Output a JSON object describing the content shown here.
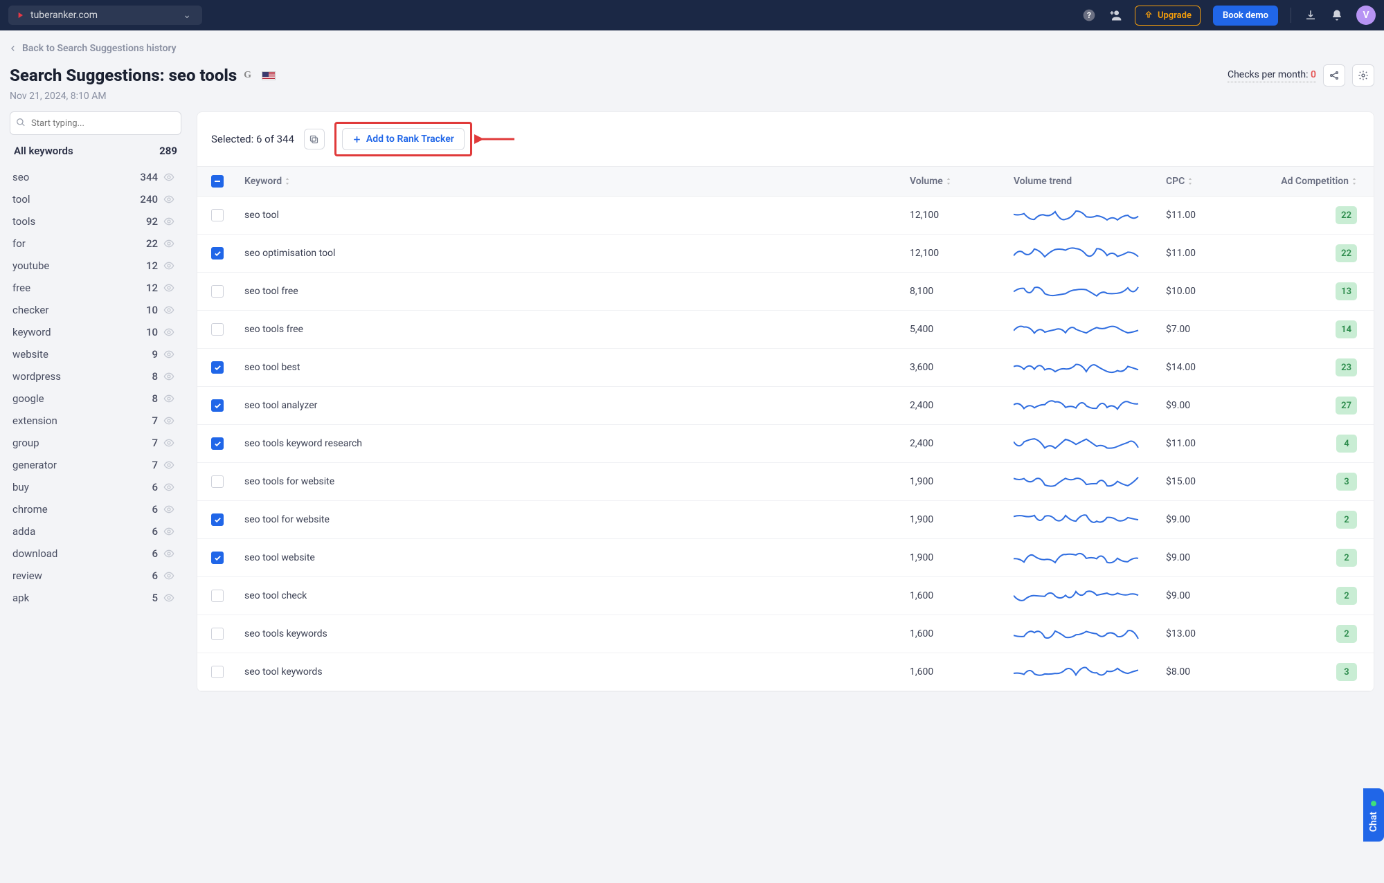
{
  "topbar": {
    "url": "tuberanker.com",
    "upgrade": "Upgrade",
    "book": "Book demo",
    "avatar": "V"
  },
  "header": {
    "back": "Back to Search Suggestions history",
    "title_prefix": "Search Suggestions: ",
    "title_query": "seo tools",
    "timestamp": "Nov 21, 2024, 8:10 AM",
    "checks_label": "Checks per month: ",
    "checks_value": "0"
  },
  "sidebar": {
    "placeholder": "Start typing...",
    "all_label": "All keywords",
    "all_count": "289",
    "items": [
      {
        "word": "seo",
        "count": "344"
      },
      {
        "word": "tool",
        "count": "240"
      },
      {
        "word": "tools",
        "count": "92"
      },
      {
        "word": "for",
        "count": "22"
      },
      {
        "word": "youtube",
        "count": "12"
      },
      {
        "word": "free",
        "count": "12"
      },
      {
        "word": "checker",
        "count": "10"
      },
      {
        "word": "keyword",
        "count": "10"
      },
      {
        "word": "website",
        "count": "9"
      },
      {
        "word": "wordpress",
        "count": "8"
      },
      {
        "word": "google",
        "count": "8"
      },
      {
        "word": "extension",
        "count": "7"
      },
      {
        "word": "group",
        "count": "7"
      },
      {
        "word": "generator",
        "count": "7"
      },
      {
        "word": "buy",
        "count": "6"
      },
      {
        "word": "chrome",
        "count": "6"
      },
      {
        "word": "adda",
        "count": "6"
      },
      {
        "word": "download",
        "count": "6"
      },
      {
        "word": "review",
        "count": "6"
      },
      {
        "word": "apk",
        "count": "5"
      }
    ]
  },
  "panel": {
    "selected": "Selected: 6 of 344",
    "add_btn": "Add to Rank Tracker",
    "columns": {
      "keyword": "Keyword",
      "volume": "Volume",
      "trend": "Volume trend",
      "cpc": "CPC",
      "ad": "Ad Competition"
    }
  },
  "rows": [
    {
      "checked": false,
      "keyword": "seo tool",
      "volume": "12,100",
      "cpc": "$11.00",
      "ad": "22"
    },
    {
      "checked": true,
      "keyword": "seo optimisation tool",
      "volume": "12,100",
      "cpc": "$11.00",
      "ad": "22"
    },
    {
      "checked": false,
      "keyword": "seo tool free",
      "volume": "8,100",
      "cpc": "$10.00",
      "ad": "13"
    },
    {
      "checked": false,
      "keyword": "seo tools free",
      "volume": "5,400",
      "cpc": "$7.00",
      "ad": "14"
    },
    {
      "checked": true,
      "keyword": "seo tool best",
      "volume": "3,600",
      "cpc": "$14.00",
      "ad": "23"
    },
    {
      "checked": true,
      "keyword": "seo tool analyzer",
      "volume": "2,400",
      "cpc": "$9.00",
      "ad": "27"
    },
    {
      "checked": true,
      "keyword": "seo tools keyword research",
      "volume": "2,400",
      "cpc": "$11.00",
      "ad": "4"
    },
    {
      "checked": false,
      "keyword": "seo tools for website",
      "volume": "1,900",
      "cpc": "$15.00",
      "ad": "3"
    },
    {
      "checked": true,
      "keyword": "seo tool for website",
      "volume": "1,900",
      "cpc": "$9.00",
      "ad": "2"
    },
    {
      "checked": true,
      "keyword": "seo tool website",
      "volume": "1,900",
      "cpc": "$9.00",
      "ad": "2"
    },
    {
      "checked": false,
      "keyword": "seo tool check",
      "volume": "1,600",
      "cpc": "$9.00",
      "ad": "2"
    },
    {
      "checked": false,
      "keyword": "seo tools keywords",
      "volume": "1,600",
      "cpc": "$13.00",
      "ad": "2"
    },
    {
      "checked": false,
      "keyword": "seo tool keywords",
      "volume": "1,600",
      "cpc": "$8.00",
      "ad": "3"
    }
  ],
  "chat": "Chat"
}
